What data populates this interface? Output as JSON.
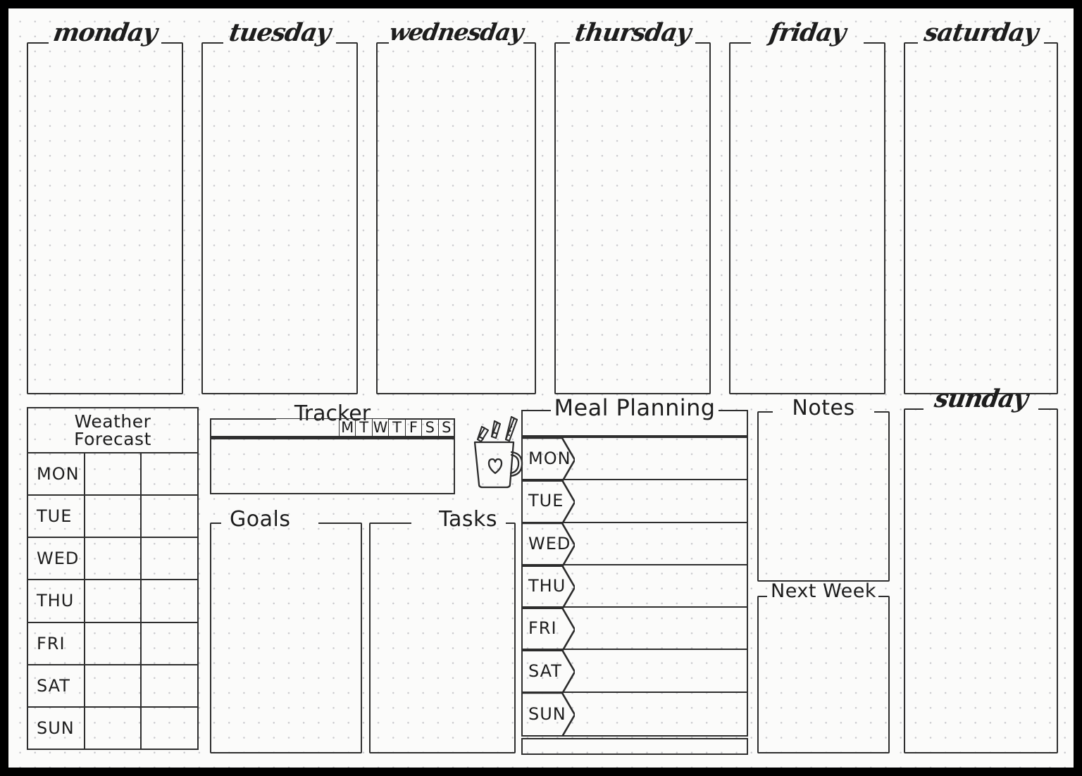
{
  "meta": {
    "page_kind": "bullet-journal-weekly-spread",
    "ink_color": "#2b2b2b",
    "paper_color": "#fbfbfa",
    "dot_color": "#c9c9cd",
    "border_color": "#000000"
  },
  "day_columns": [
    {
      "label": "monday"
    },
    {
      "label": "tuesday"
    },
    {
      "label": "wednesday"
    },
    {
      "label": "thursday"
    },
    {
      "label": "friday"
    },
    {
      "label": "saturday"
    }
  ],
  "sunday_column": {
    "label": "sunday"
  },
  "weather": {
    "title_line1": "Weather",
    "title_line2": "Forecast",
    "rows": [
      {
        "day": "MON",
        "col2": "",
        "col3": ""
      },
      {
        "day": "TUE",
        "col2": "",
        "col3": ""
      },
      {
        "day": "WED",
        "col2": "",
        "col3": ""
      },
      {
        "day": "THU",
        "col2": "",
        "col3": ""
      },
      {
        "day": "FRI",
        "col2": "",
        "col3": ""
      },
      {
        "day": "SAT",
        "col2": "",
        "col3": ""
      },
      {
        "day": "SUN",
        "col2": "",
        "col3": ""
      }
    ]
  },
  "tracker": {
    "title": "Tracker",
    "day_headers": [
      "M",
      "T",
      "W",
      "T",
      "F",
      "S",
      "S"
    ],
    "rows": [
      {
        "habit": "",
        "marks": [
          "",
          "",
          "",
          "",
          "",
          "",
          ""
        ]
      },
      {
        "habit": "",
        "marks": [
          "",
          "",
          "",
          "",
          "",
          "",
          ""
        ]
      },
      {
        "habit": "",
        "marks": [
          "",
          "",
          "",
          "",
          "",
          "",
          ""
        ]
      },
      {
        "habit": "",
        "marks": [
          "",
          "",
          "",
          "",
          "",
          "",
          ""
        ]
      },
      {
        "habit": "",
        "marks": [
          "",
          "",
          "",
          "",
          "",
          "",
          ""
        ]
      }
    ]
  },
  "goals": {
    "title": "Goals",
    "content": ""
  },
  "tasks": {
    "title": "Tasks",
    "content": ""
  },
  "meal_planning": {
    "title": "Meal Planning",
    "rows": [
      {
        "day": "MON",
        "meal": ""
      },
      {
        "day": "TUE",
        "meal": ""
      },
      {
        "day": "WED",
        "meal": ""
      },
      {
        "day": "THU",
        "meal": ""
      },
      {
        "day": "FRI",
        "meal": ""
      },
      {
        "day": "SAT",
        "meal": ""
      },
      {
        "day": "SUN",
        "meal": ""
      }
    ]
  },
  "notes": {
    "title": "Notes",
    "content": ""
  },
  "next_week": {
    "title": "Next Week",
    "content": ""
  },
  "doodle": {
    "name": "pencil-cup-with-heart"
  }
}
